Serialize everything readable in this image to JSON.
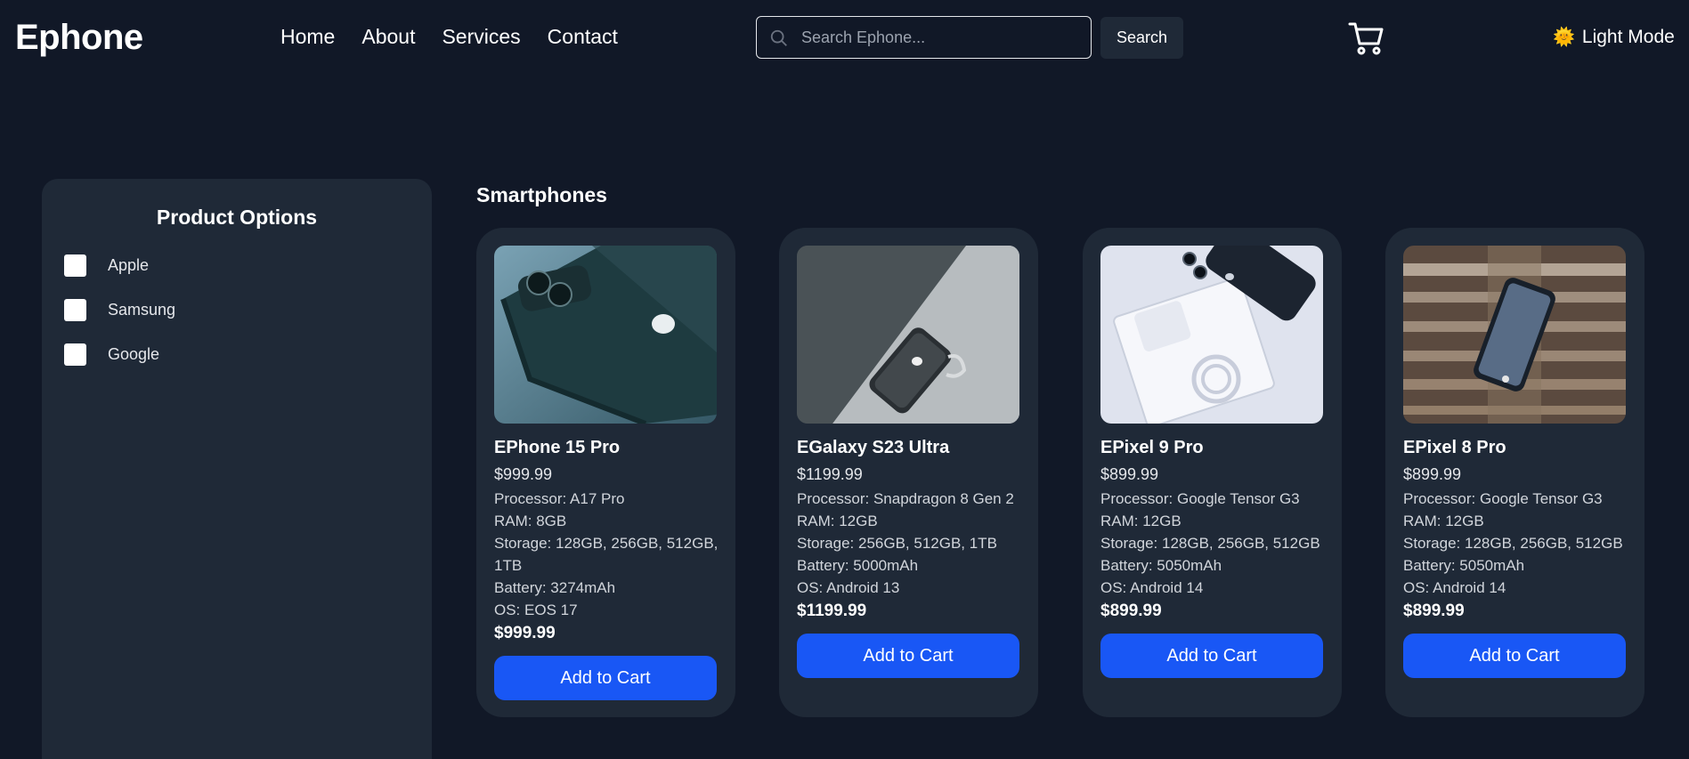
{
  "header": {
    "logo": "Ephone",
    "nav": [
      "Home",
      "About",
      "Services",
      "Contact"
    ],
    "search_placeholder": "Search Ephone...",
    "search_button": "Search",
    "mode_label": "Light Mode",
    "mode_icon": "sun-icon"
  },
  "sidebar": {
    "title": "Product Options",
    "options": [
      {
        "label": "Apple",
        "checked": false
      },
      {
        "label": "Samsung",
        "checked": false
      },
      {
        "label": "Google",
        "checked": false
      }
    ]
  },
  "main": {
    "section_title": "Smartphones",
    "products": [
      {
        "name": "EPhone 15 Pro",
        "price": "$999.99",
        "specs": [
          "Processor: A17 Pro",
          "RAM: 8GB",
          "Storage: 128GB, 256GB, 512GB, 1TB",
          "Battery: 3274mAh",
          "OS: EOS 17"
        ],
        "price_bold": "$999.99",
        "button": "Add to Cart"
      },
      {
        "name": "EGalaxy S23 Ultra",
        "price": "$1199.99",
        "specs": [
          "Processor: Snapdragon 8 Gen 2",
          "RAM: 12GB",
          "Storage: 256GB, 512GB, 1TB",
          "Battery: 5000mAh",
          "OS: Android 13"
        ],
        "price_bold": "$1199.99",
        "button": "Add to Cart"
      },
      {
        "name": "EPixel 9 Pro",
        "price": "$899.99",
        "specs": [
          "Processor: Google Tensor G3",
          "RAM: 12GB",
          "Storage: 128GB, 256GB, 512GB",
          "Battery: 5050mAh",
          "OS: Android 14"
        ],
        "price_bold": "$899.99",
        "button": "Add to Cart"
      },
      {
        "name": "EPixel 8 Pro",
        "price": "$899.99",
        "specs": [
          "Processor: Google Tensor G3",
          "RAM: 12GB",
          "Storage: 128GB, 256GB, 512GB",
          "Battery: 5050mAh",
          "OS: Android 14"
        ],
        "price_bold": "$899.99",
        "button": "Add to Cart"
      }
    ]
  },
  "colors": {
    "background": "#111827",
    "panel": "#1f2937",
    "accent": "#1957f5"
  }
}
